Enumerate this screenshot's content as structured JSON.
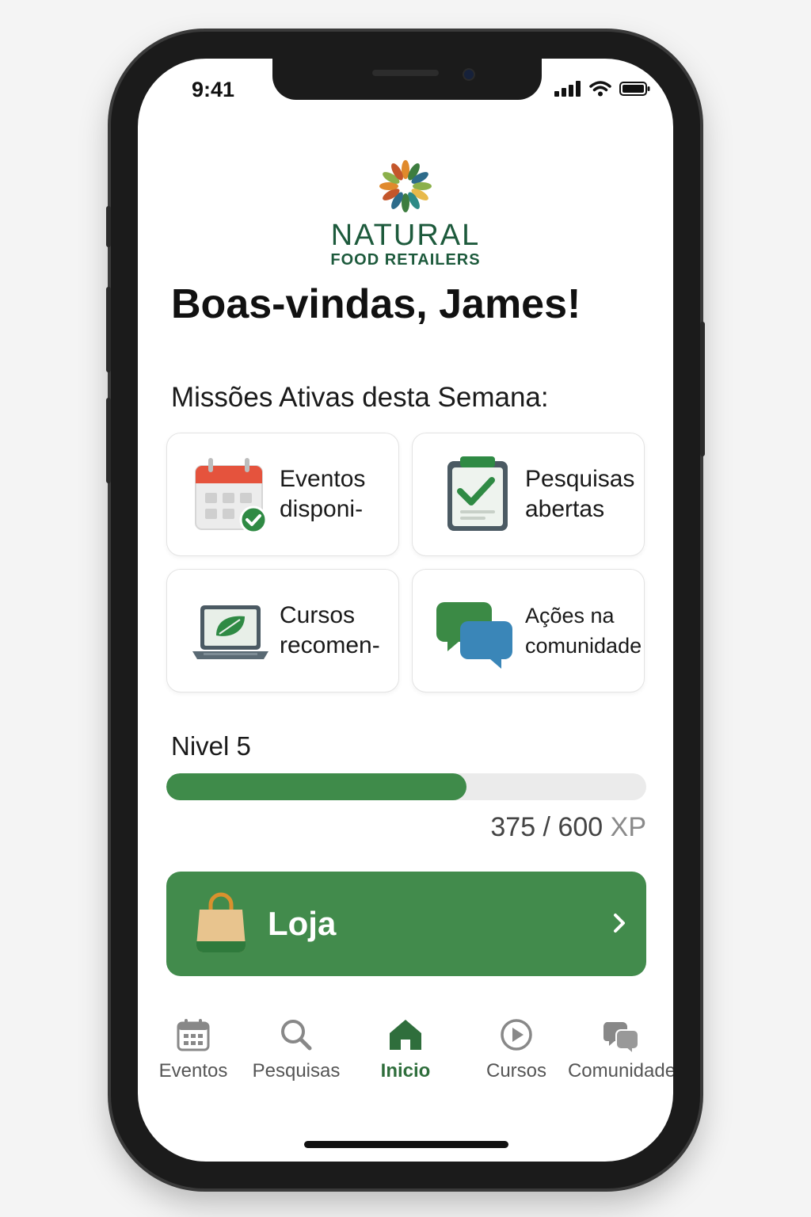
{
  "status_bar": {
    "time": "9:41"
  },
  "brand": {
    "name": "NATURAL",
    "subtitle": "FOOD RETAILERS"
  },
  "greeting": "Boas-vindas, James!",
  "missions": {
    "title": "Missões Ativas desta Semana:",
    "cards": [
      {
        "label": "Eventos\ndisponi-",
        "icon": "calendar-check-icon"
      },
      {
        "label": "Pesquisas\nabertas",
        "icon": "clipboard-check-icon"
      },
      {
        "label": "Cursos\nrecomen-",
        "icon": "laptop-leaf-icon"
      },
      {
        "label": "Ações na\ncomunidade",
        "icon": "chat-bubbles-icon"
      }
    ]
  },
  "level": {
    "label": "Nivel 5",
    "xp_current": "375",
    "xp_total": "600",
    "xp_unit": "XP",
    "progress_fraction": 0.625
  },
  "shop": {
    "label": "Loja",
    "icon": "shopping-bag-icon"
  },
  "tabbar": {
    "tabs": [
      {
        "label": "Eventos",
        "icon": "calendar-icon"
      },
      {
        "label": "Pesquisas",
        "icon": "search-icon"
      },
      {
        "label": "Inicio",
        "icon": "home-icon",
        "active": true
      },
      {
        "label": "Cursos",
        "icon": "play-circle-icon"
      },
      {
        "label": "Comunidade",
        "icon": "chat-icon"
      }
    ]
  },
  "colors": {
    "brand_green": "#428b4c",
    "dark_green": "#1d5a3c"
  }
}
